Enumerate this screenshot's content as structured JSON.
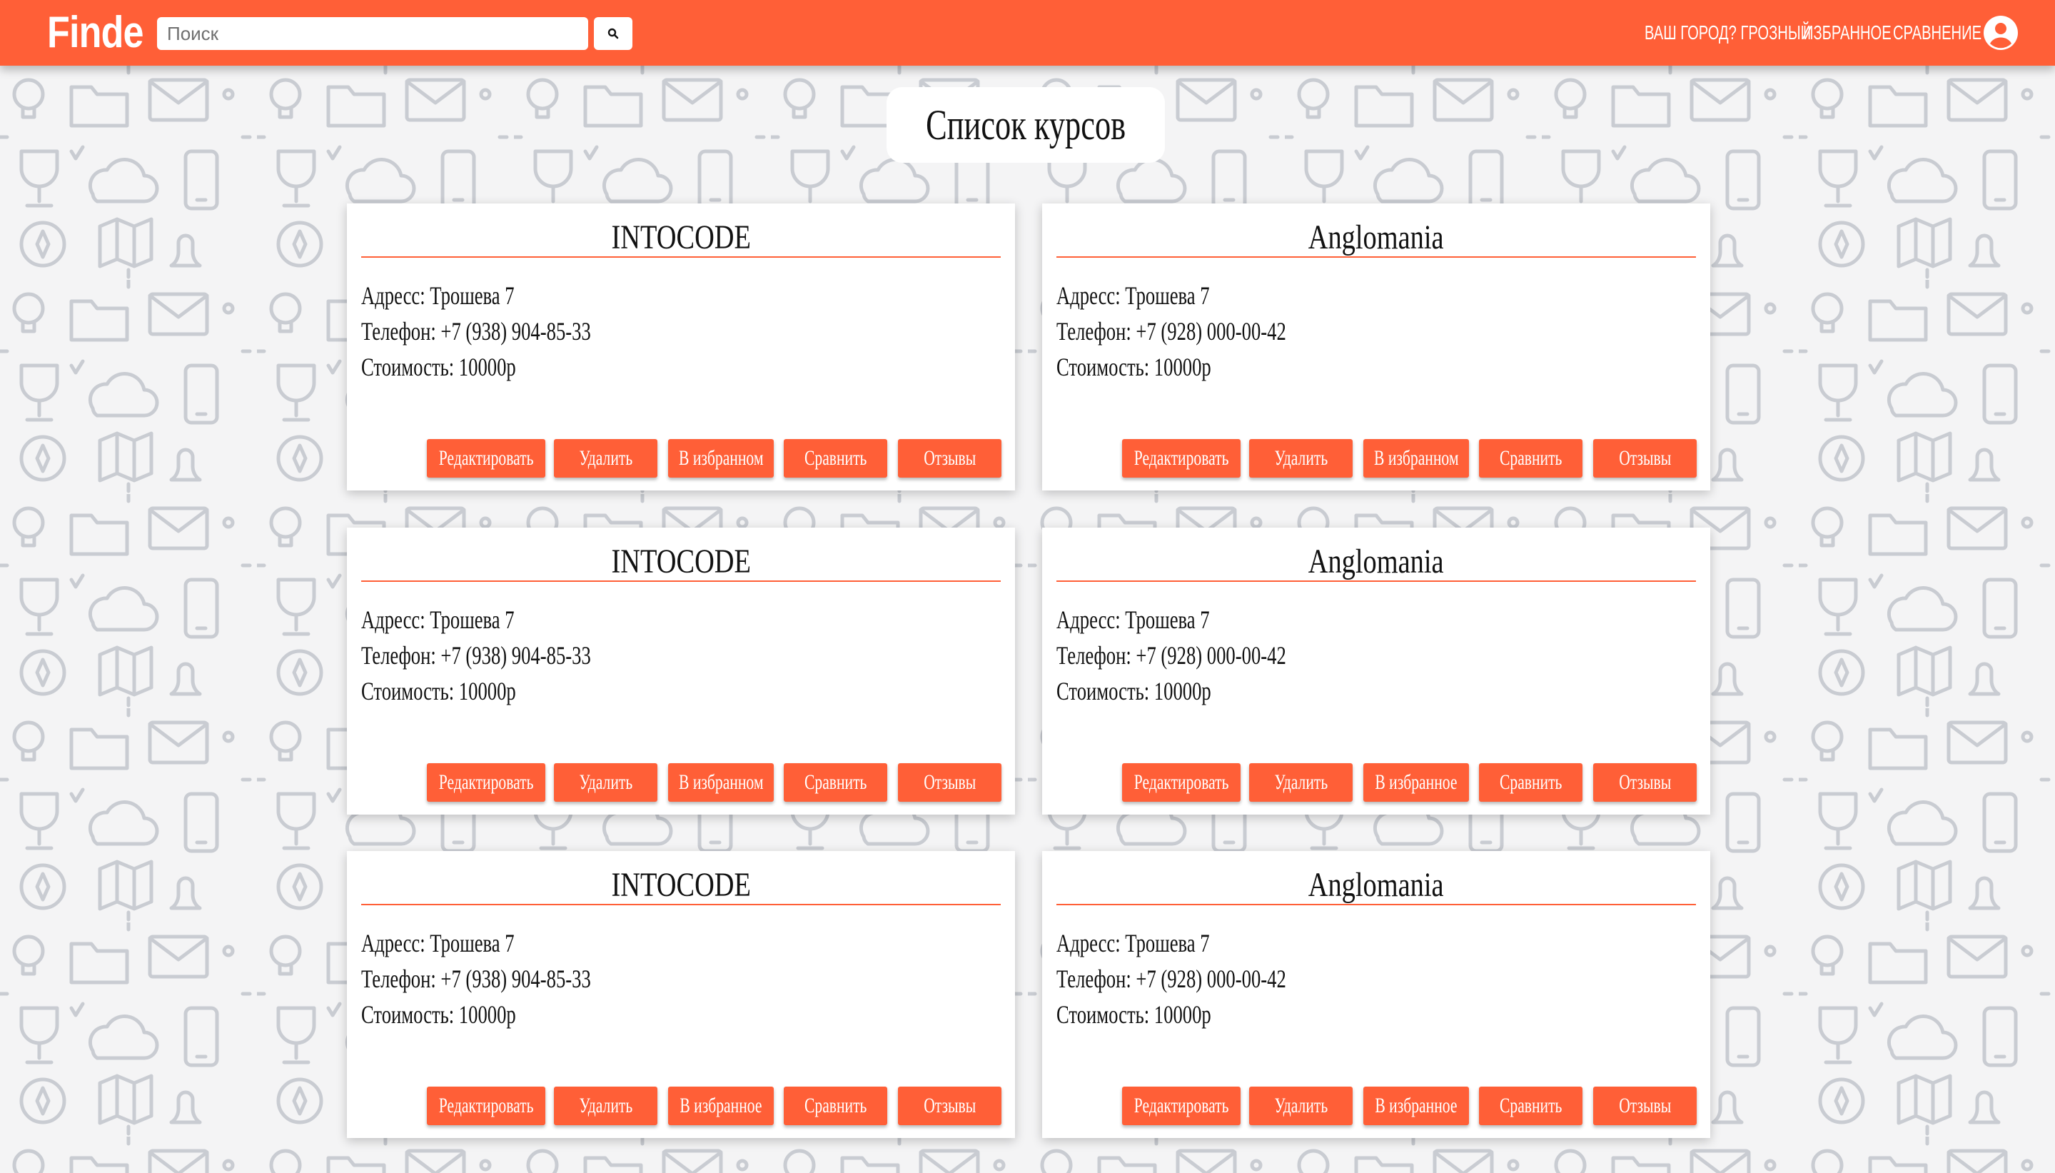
{
  "colors": {
    "accent": "#ff5f37",
    "background": "#f4f4f5",
    "pattern": "#c9ccd2",
    "card": "#ffffff",
    "text": "#111111"
  },
  "header": {
    "logo": "Finde",
    "search": {
      "placeholder": "Поиск",
      "value": "",
      "button_icon": "search-icon"
    },
    "nav": {
      "city": "Ваш город? Грозный",
      "favorites": "Избранное",
      "compare": "Сравнение",
      "user_icon": "user-icon"
    }
  },
  "page": {
    "title": "Список курсов"
  },
  "courses": [
    {
      "name": "INTOCODE",
      "address": "Адресс: Трошева 7",
      "phone": "Телефон: +7 (938) 904-85-33",
      "price": "Стоимость: 10000р",
      "buttons": {
        "edit": "Редактировать",
        "delete": "Удалить",
        "favorite": "В избранном",
        "compare": "Сравнить",
        "reviews": "Отзывы"
      }
    },
    {
      "name": "Anglomania",
      "address": "Адресс: Трошева 7",
      "phone": "Телефон: +7 (928) 000-00-42",
      "price": "Стоимость: 10000р",
      "buttons": {
        "edit": "Редактировать",
        "delete": "Удалить",
        "favorite": "В избранном",
        "compare": "Сравнить",
        "reviews": "Отзывы"
      }
    },
    {
      "name": "INTOCODE",
      "address": "Адресс: Трошева 7",
      "phone": "Телефон: +7 (938) 904-85-33",
      "price": "Стоимость: 10000р",
      "buttons": {
        "edit": "Редактировать",
        "delete": "Удалить",
        "favorite": "В избранном",
        "compare": "Сравнить",
        "reviews": "Отзывы"
      }
    },
    {
      "name": "Anglomania",
      "address": "Адресс: Трошева 7",
      "phone": "Телефон: +7 (928) 000-00-42",
      "price": "Стоимость: 10000р",
      "buttons": {
        "edit": "Редактировать",
        "delete": "Удалить",
        "favorite": "В избранное",
        "compare": "Сравнить",
        "reviews": "Отзывы"
      }
    },
    {
      "name": "INTOCODE",
      "address": "Адресс: Трошева 7",
      "phone": "Телефон: +7 (938) 904-85-33",
      "price": "Стоимость: 10000р",
      "buttons": {
        "edit": "Редактировать",
        "delete": "Удалить",
        "favorite": "В избранное",
        "compare": "Сравнить",
        "reviews": "Отзывы"
      }
    },
    {
      "name": "Anglomania",
      "address": "Адресс: Трошева 7",
      "phone": "Телефон: +7 (928) 000-00-42",
      "price": "Стоимость: 10000р",
      "buttons": {
        "edit": "Редактировать",
        "delete": "Удалить",
        "favorite": "В избранное",
        "compare": "Сравнить",
        "reviews": "Отзывы"
      }
    }
  ]
}
